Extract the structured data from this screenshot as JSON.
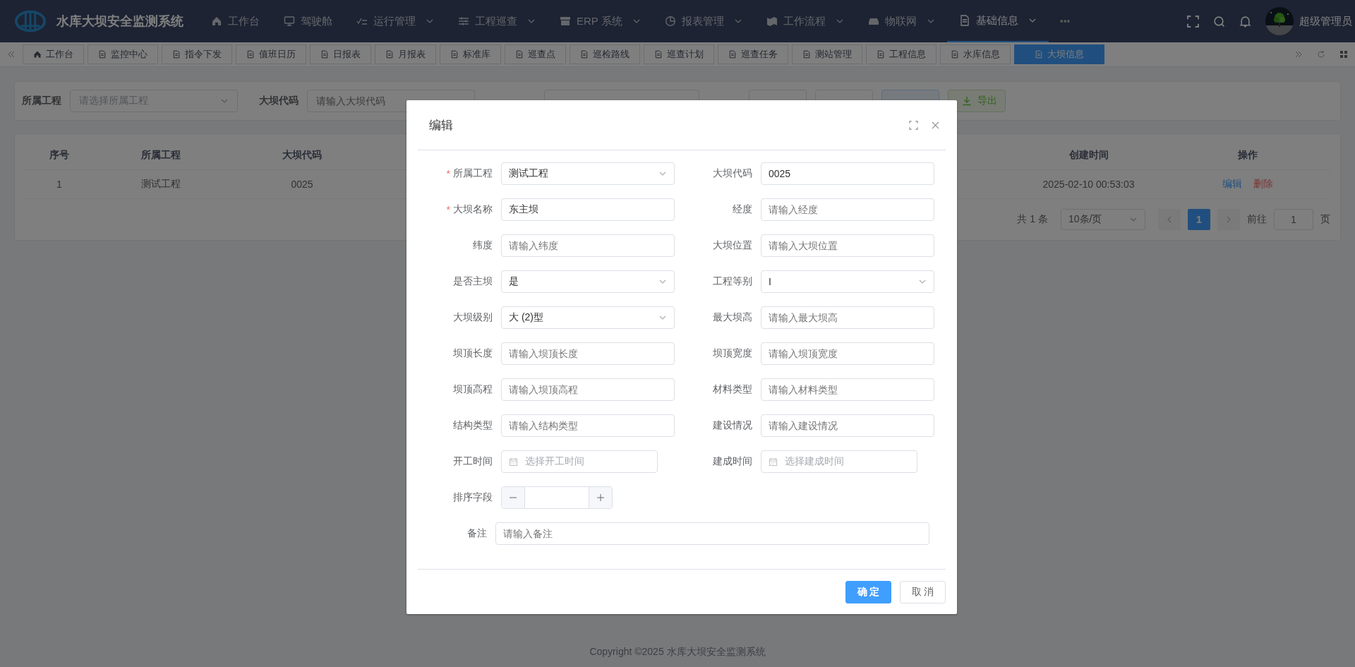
{
  "app": {
    "title": "水库大坝安全监测系统"
  },
  "nav": [
    {
      "label": "工作台",
      "has_menu": false,
      "selected": false
    },
    {
      "label": "驾驶舱",
      "has_menu": false,
      "selected": false
    },
    {
      "label": "运行管理",
      "has_menu": true,
      "selected": false
    },
    {
      "label": "工程巡查",
      "has_menu": true,
      "selected": false
    },
    {
      "label": "ERP 系统",
      "has_menu": true,
      "selected": false
    },
    {
      "label": "报表管理",
      "has_menu": true,
      "selected": false
    },
    {
      "label": "工作流程",
      "has_menu": true,
      "selected": false
    },
    {
      "label": "物联网",
      "has_menu": true,
      "selected": false
    },
    {
      "label": "基础信息",
      "has_menu": true,
      "selected": true
    }
  ],
  "nav_more": "•••",
  "user": {
    "name": "超级管理员"
  },
  "tabs": [
    {
      "label": "工作台",
      "selected": false
    },
    {
      "label": "监控中心",
      "selected": false
    },
    {
      "label": "指令下发",
      "selected": false
    },
    {
      "label": "值班日历",
      "selected": false
    },
    {
      "label": "日报表",
      "selected": false
    },
    {
      "label": "月报表",
      "selected": false
    },
    {
      "label": "标准库",
      "selected": false
    },
    {
      "label": "巡查点",
      "selected": false
    },
    {
      "label": "巡检路线",
      "selected": false
    },
    {
      "label": "巡查计划",
      "selected": false
    },
    {
      "label": "巡查任务",
      "selected": false
    },
    {
      "label": "测站管理",
      "selected": false
    },
    {
      "label": "工程信息",
      "selected": false
    },
    {
      "label": "水库信息",
      "selected": false
    },
    {
      "label": "大坝信息",
      "selected": true
    }
  ],
  "search": {
    "fields": [
      {
        "label": "所属工程",
        "kind": "select",
        "placeholder": "请选择所属工程"
      },
      {
        "label": "大坝代码",
        "kind": "input",
        "placeholder": "请输入大坝代码"
      }
    ],
    "buttons": [
      {
        "kind": "search"
      },
      {
        "kind": "reset"
      },
      {
        "kind": "add"
      },
      {
        "label": "导出",
        "kind": "export"
      }
    ]
  },
  "table": {
    "columns": [
      "序号",
      "所属工程",
      "大坝代码",
      "创建时间",
      "操作"
    ],
    "rows": [
      {
        "cells": [
          "1",
          "测试工程",
          "0025",
          "2025-02-10 00:53:03"
        ],
        "actions": [
          "编辑",
          "删除"
        ]
      }
    ]
  },
  "pagination": {
    "total": "共 1 条",
    "page_size": "10条/页",
    "pages": [
      {
        "label": "1",
        "selected": true
      }
    ],
    "goto_label": "前往",
    "goto_value": "1",
    "goto_suffix": "页"
  },
  "dialog": {
    "title": "编辑",
    "fields": [
      {
        "label": "所属工程",
        "kind": "select",
        "value": "测试工程",
        "required_mark": "*"
      },
      {
        "label": "大坝代码",
        "kind": "input",
        "value": "0025"
      },
      {
        "label": "大坝名称",
        "kind": "input",
        "value": "东主坝",
        "required_mark": "*"
      },
      {
        "label": "经度",
        "kind": "input",
        "placeholder": "请输入经度"
      },
      {
        "label": "纬度",
        "kind": "input",
        "placeholder": "请输入纬度"
      },
      {
        "label": "大坝位置",
        "kind": "input",
        "placeholder": "请输入大坝位置"
      },
      {
        "label": "是否主坝",
        "kind": "select",
        "value": "是"
      },
      {
        "label": "工程等别",
        "kind": "select",
        "value": "I"
      },
      {
        "label": "大坝级别",
        "kind": "select",
        "value": "大 (2)型"
      },
      {
        "label": "最大坝高",
        "kind": "input",
        "placeholder": "请输入最大坝高"
      },
      {
        "label": "坝顶长度",
        "kind": "input",
        "placeholder": "请输入坝顶长度"
      },
      {
        "label": "坝顶宽度",
        "kind": "input",
        "placeholder": "请输入坝顶宽度"
      },
      {
        "label": "坝顶高程",
        "kind": "input",
        "placeholder": "请输入坝顶高程"
      },
      {
        "label": "材料类型",
        "kind": "input",
        "placeholder": "请输入材料类型"
      },
      {
        "label": "结构类型",
        "kind": "input",
        "placeholder": "请输入结构类型"
      },
      {
        "label": "建设情况",
        "kind": "input",
        "placeholder": "请输入建设情况"
      },
      {
        "label": "开工时间",
        "kind": "date",
        "placeholder": "选择开工时间"
      },
      {
        "label": "建成时间",
        "kind": "date",
        "placeholder": "选择建成时间"
      },
      {
        "label": "排序字段",
        "kind": "number"
      },
      {
        "label": "备注",
        "kind": "wide",
        "placeholder": "请输入备注"
      }
    ],
    "buttons": [
      {
        "label": "确 定",
        "kind": "primary"
      },
      {
        "label": "取 消",
        "kind": "default"
      }
    ]
  },
  "footer": "Copyright ©2025 水库大坝安全监测系统"
}
